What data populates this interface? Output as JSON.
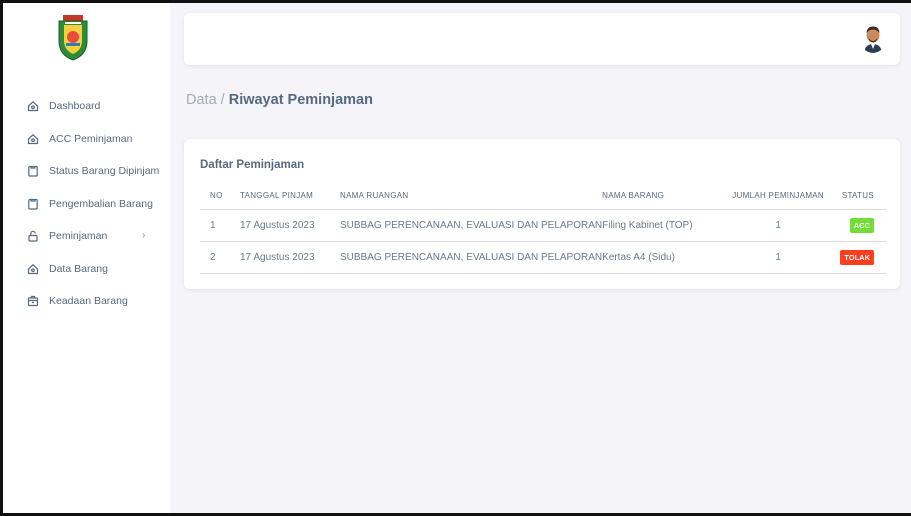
{
  "sidebar": {
    "logo_icon": "regency-crest-logo",
    "items": [
      {
        "label": "Dashboard",
        "icon": "home-icon"
      },
      {
        "label": "ACC Peminjaman",
        "icon": "home-icon"
      },
      {
        "label": "Status Barang Dipinjam",
        "icon": "clipboard-icon"
      },
      {
        "label": "Pengembalian Barang",
        "icon": "clipboard-icon"
      },
      {
        "label": "Peminjaman",
        "icon": "lock-icon",
        "chevron": "›"
      },
      {
        "label": "Data Barang",
        "icon": "home-icon"
      },
      {
        "label": "Keadaan Barang",
        "icon": "box-icon"
      }
    ]
  },
  "navbar": {
    "avatar_icon": "user-avatar"
  },
  "breadcrumb": {
    "parent": "Data / ",
    "current": "Riwayat Peminjaman"
  },
  "card": {
    "title": "Daftar Peminjaman",
    "headers": [
      "NO",
      "TANGGAL PINJAM",
      "NAMA RUANGAN",
      "NAMA BARANG",
      "JUMLAH PEMINJAMAN",
      "STATUS"
    ],
    "rows": [
      {
        "no": "1",
        "tanggal": "17 Agustus 2023",
        "ruangan": "SUBBAG PERENCANAAN, EVALUASI DAN PELAPORAN",
        "barang": "Filing Kabinet (TOP)",
        "jumlah": "1",
        "status": "ACC"
      },
      {
        "no": "2",
        "tanggal": "17 Agustus 2023",
        "ruangan": "SUBBAG PERENCANAAN, EVALUASI DAN PELAPORAN",
        "barang": "Kertas A4 (Sidu)",
        "jumlah": "1",
        "status": "TOLAK"
      }
    ]
  },
  "colors": {
    "acc": "#71dd37",
    "tolak": "#ff3e1d",
    "text": "#566a7f",
    "background": "#f5f5f9"
  }
}
